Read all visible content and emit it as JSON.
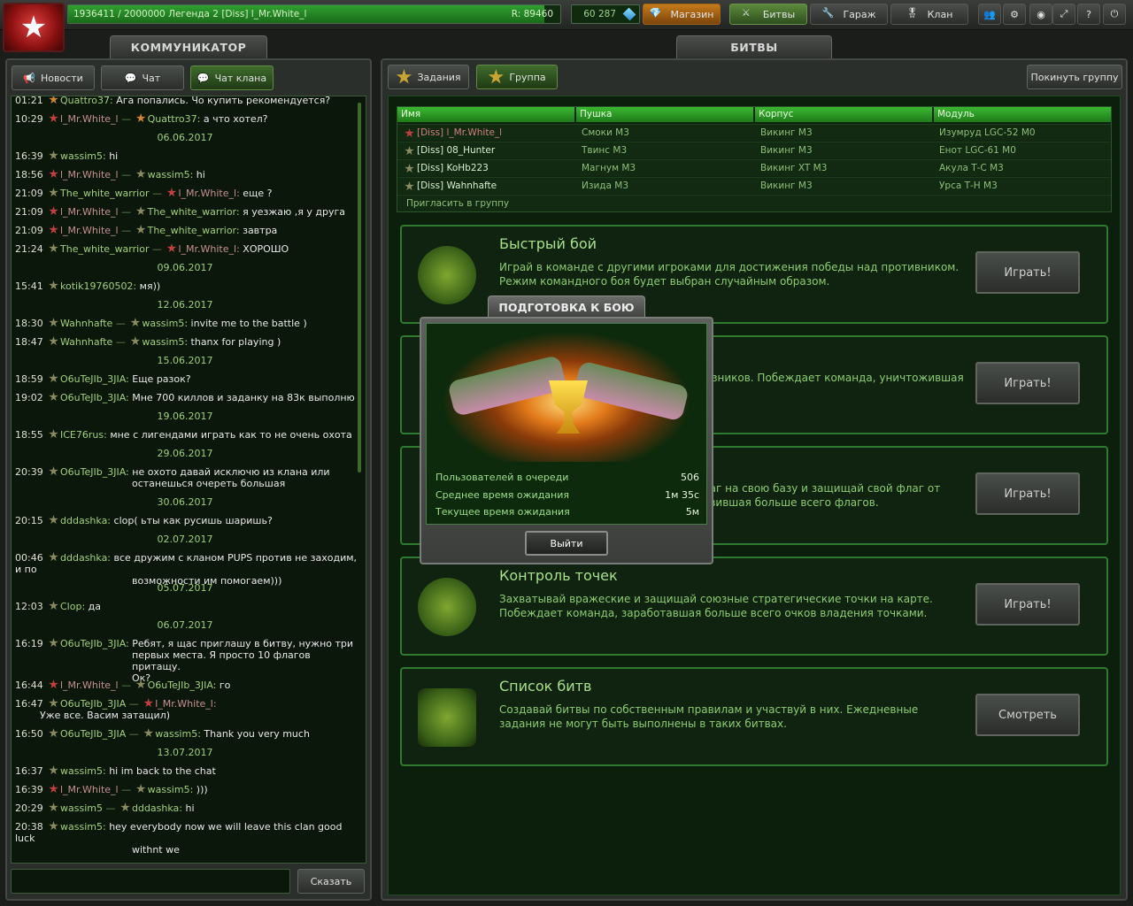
{
  "topbar": {
    "xp_text": "1936411 / 2000000  Легенда 2 [Diss] l_Mr.White_l",
    "xp_fraction": 0.968,
    "rating": "R: 89460",
    "crystals": "60 287",
    "shop": "Магазин",
    "battles": "Битвы",
    "garage": "Гараж",
    "clan": "Клан",
    "help": "?"
  },
  "left": {
    "tab": "КОММУНИКАТОР",
    "news": "Новости",
    "chat": "Чат",
    "clan_chat": "Чат клана",
    "say": "Сказать"
  },
  "chat": [
    {
      "time": "01:21",
      "from": "Quattro37:",
      "text": "Ага попались. Чо купить рекомендуется?"
    },
    {
      "time": "10:29",
      "from": "l_Mr.White_l",
      "to": "Quattro37:",
      "text": "а что хотел?"
    },
    {
      "date": "06.06.2017"
    },
    {
      "time": "16:39",
      "from": "wassim5:",
      "text": "hi"
    },
    {
      "time": "18:56",
      "from": "l_Mr.White_l",
      "to": "wassim5:",
      "text": "hi"
    },
    {
      "time": "21:09",
      "from": "The_white_warrior",
      "to": "l_Mr.White_l:",
      "text": "еще ?"
    },
    {
      "time": "21:09",
      "from": "l_Mr.White_l",
      "to": "The_white_warrior:",
      "text": "я уезжаю ,я у друга"
    },
    {
      "time": "21:09",
      "from": "l_Mr.White_l",
      "to": "The_white_warrior:",
      "text": "завтра"
    },
    {
      "time": "21:24",
      "from": "The_white_warrior",
      "to": "l_Mr.White_l:",
      "text": "ХОРОШО"
    },
    {
      "date": "09.06.2017"
    },
    {
      "time": "15:41",
      "from": "kotik19760502:",
      "text": "мя))"
    },
    {
      "date": "12.06.2017"
    },
    {
      "time": "18:30",
      "from": "Wahnhafte",
      "to": "wassim5:",
      "text": "invite me to the battle )"
    },
    {
      "time": "18:47",
      "from": "Wahnhafte",
      "to": "wassim5:",
      "text": "thanx for playing )"
    },
    {
      "date": "15.06.2017"
    },
    {
      "time": "18:59",
      "from": "O6uTeJIb_3JIA:",
      "text": "Еще разок?"
    },
    {
      "time": "19:02",
      "from": "O6uTeJIb_3JIA:",
      "text": "Мне 700 киллов и заданку на 83к выполню"
    },
    {
      "date": "19.06.2017"
    },
    {
      "time": "18:55",
      "from": "ICE76rus:",
      "text": "мне с лигендами играть как то не очень охота"
    },
    {
      "date": "29.06.2017"
    },
    {
      "time": "20:39",
      "from": "O6uTeJIb_3JIA:",
      "text": "не охото давай исключю из клана или",
      "text2": "останешься очереть большая"
    },
    {
      "date": "30.06.2017"
    },
    {
      "time": "20:15",
      "from": "dddashka:",
      "text": "clop( ьты как русишь шаришь?"
    },
    {
      "date": "02.07.2017"
    },
    {
      "time": "00:46",
      "from": "dddashka:",
      "text": "все дружим с кланом PUPS против не заходим, и по",
      "text2": "возможности им помогаем)))"
    },
    {
      "date": "05.07.2017"
    },
    {
      "time": "12:03",
      "from": "Clop:",
      "text": "да"
    },
    {
      "date": "06.07.2017"
    },
    {
      "time": "16:19",
      "from": "O6uTeJIb_3JIA:",
      "text": "Ребят, я щас приглашу в битву, нужно три",
      "text2": "первых места. Я просто 10 флагов притащу.",
      "text3": "Ок?"
    },
    {
      "time": "16:44",
      "from": "l_Mr.White_l",
      "to": "O6uTeJIb_3JIA:",
      "text": "го"
    },
    {
      "time": "16:47",
      "from": "O6uTeJIb_3JIA",
      "to": "l_Mr.White_l:",
      "text": "",
      "text2": "Уже все. Васим затащил)"
    },
    {
      "time": "16:50",
      "from": "O6uTeJIb_3JIA",
      "to": "wassim5:",
      "text": "Thank you very much"
    },
    {
      "date": "13.07.2017"
    },
    {
      "time": "16:37",
      "from": "wassim5:",
      "text": "hi im back to the chat"
    },
    {
      "time": "16:39",
      "from": "l_Mr.White_l",
      "to": "wassim5:",
      "text": ")))"
    },
    {
      "time": "20:29",
      "from": "wassim5",
      "to": "dddashka:",
      "text": "hi"
    },
    {
      "time": "20:38",
      "from": "wassim5:",
      "text": "hey everybody now we will leave this clan good luck",
      "text2": "withnt we"
    }
  ],
  "right": {
    "tab": "БИТВЫ",
    "tasks": "Задания",
    "group": "Группа",
    "leave_group": "Покинуть группу",
    "columns": [
      "Имя",
      "Пушка",
      "Корпус",
      "Модуль"
    ],
    "rows": [
      [
        "[Diss] l_Mr.White_l",
        "Смоки М3",
        "Викинг М3",
        "Изумруд LGC-52 M0"
      ],
      [
        "[Diss] 08_Hunter",
        "Твинс М3",
        "Викинг М3",
        "Енот LGC-61 M0"
      ],
      [
        "[Diss] KoHb223",
        "Магнум М3",
        "Викинг XT М3",
        "Акула Т-С М3"
      ],
      [
        "[Diss] Wahnhafte",
        "Изида М3",
        "Викинг М3",
        "Урса Т-Н М3"
      ]
    ],
    "invite": "Пригласить в группу",
    "modes": [
      {
        "title": "Быстрый бой",
        "desc": "Играй в команде с другими игроками для достижения победы над противником. Режим командного боя будет выбран случайным образом.",
        "button": "Играть!"
      },
      {
        "title": "",
        "desc": "юзников. Побеждает команда, уничтожившая",
        "button": "Играть!"
      },
      {
        "title": "",
        "desc": "лаг на свою базу и защищай свой флаг от авившая больше всего флагов.",
        "button": "Играть!"
      },
      {
        "title": "Контроль точек",
        "desc": "Захватывай вражеские и защищай союзные стратегические точки на карте. Побеждает команда, заработавшая больше всего очков владения точками.",
        "button": "Играть!"
      },
      {
        "title": "Список битв",
        "desc": "Создавай битвы по собственным правилам и участвуй в них. Ежедневные задания не могут быть выполнены в таких битвах.",
        "button": "Смотреть"
      }
    ]
  },
  "dialog": {
    "title": "ПОДГОТОВКА К БОЮ",
    "queue_label": "Пользователей в очереди",
    "queue_value": "506",
    "avg_label": "Среднее время ожидания",
    "avg_value": "1м 35с",
    "cur_label": "Текущее время ожидания",
    "cur_value": "5м",
    "exit": "Выйти"
  }
}
